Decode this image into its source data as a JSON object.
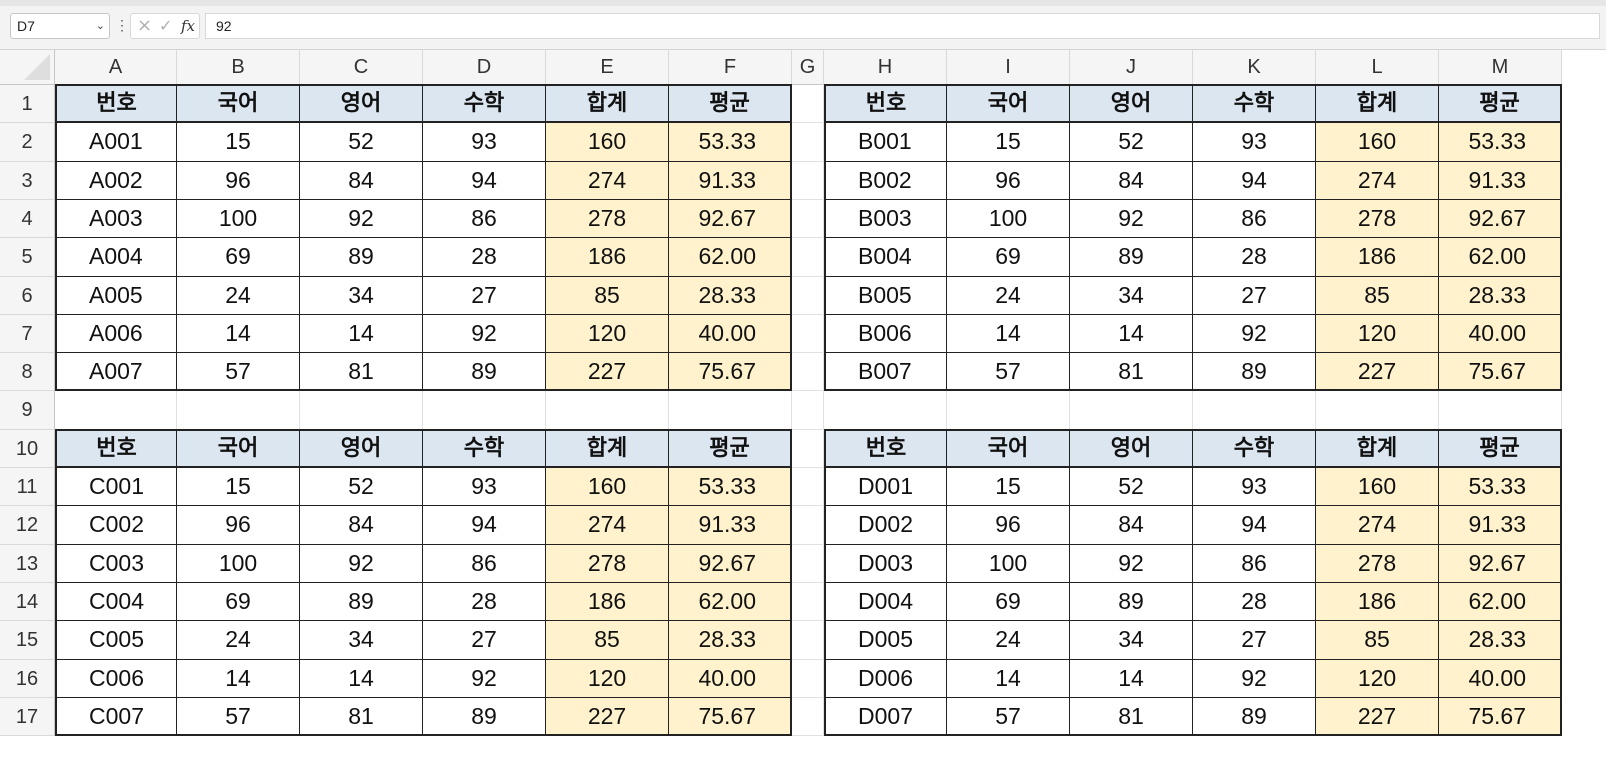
{
  "formula_bar": {
    "name_box": "D7",
    "formula": "92",
    "fx_label": "fx",
    "cancel_glyph": "×",
    "enter_glyph": "✓",
    "dropdown_glyph": "⌄",
    "dots_glyph": "⋮"
  },
  "columns": [
    "A",
    "B",
    "C",
    "D",
    "E",
    "F",
    "G",
    "H",
    "I",
    "J",
    "K",
    "L",
    "M"
  ],
  "rows": [
    "1",
    "2",
    "3",
    "4",
    "5",
    "6",
    "7",
    "8",
    "9",
    "10",
    "11",
    "12",
    "13",
    "14",
    "15",
    "16",
    "17"
  ],
  "colors": {
    "header_fill": "#dce6f1",
    "sum_fill": "#fff2cc",
    "border": "#222222"
  },
  "tables": [
    {
      "id": "A",
      "headers": [
        "번호",
        "국어",
        "영어",
        "수학",
        "합계",
        "평균"
      ],
      "rows": [
        [
          "A001",
          "15",
          "52",
          "93",
          "160",
          "53.33"
        ],
        [
          "A002",
          "96",
          "84",
          "94",
          "274",
          "91.33"
        ],
        [
          "A003",
          "100",
          "92",
          "86",
          "278",
          "92.67"
        ],
        [
          "A004",
          "69",
          "89",
          "28",
          "186",
          "62.00"
        ],
        [
          "A005",
          "24",
          "34",
          "27",
          "85",
          "28.33"
        ],
        [
          "A006",
          "14",
          "14",
          "92",
          "120",
          "40.00"
        ],
        [
          "A007",
          "57",
          "81",
          "89",
          "227",
          "75.67"
        ]
      ]
    },
    {
      "id": "B",
      "headers": [
        "번호",
        "국어",
        "영어",
        "수학",
        "합계",
        "평균"
      ],
      "rows": [
        [
          "B001",
          "15",
          "52",
          "93",
          "160",
          "53.33"
        ],
        [
          "B002",
          "96",
          "84",
          "94",
          "274",
          "91.33"
        ],
        [
          "B003",
          "100",
          "92",
          "86",
          "278",
          "92.67"
        ],
        [
          "B004",
          "69",
          "89",
          "28",
          "186",
          "62.00"
        ],
        [
          "B005",
          "24",
          "34",
          "27",
          "85",
          "28.33"
        ],
        [
          "B006",
          "14",
          "14",
          "92",
          "120",
          "40.00"
        ],
        [
          "B007",
          "57",
          "81",
          "89",
          "227",
          "75.67"
        ]
      ]
    },
    {
      "id": "C",
      "headers": [
        "번호",
        "국어",
        "영어",
        "수학",
        "합계",
        "평균"
      ],
      "rows": [
        [
          "C001",
          "15",
          "52",
          "93",
          "160",
          "53.33"
        ],
        [
          "C002",
          "96",
          "84",
          "94",
          "274",
          "91.33"
        ],
        [
          "C003",
          "100",
          "92",
          "86",
          "278",
          "92.67"
        ],
        [
          "C004",
          "69",
          "89",
          "28",
          "186",
          "62.00"
        ],
        [
          "C005",
          "24",
          "34",
          "27",
          "85",
          "28.33"
        ],
        [
          "C006",
          "14",
          "14",
          "92",
          "120",
          "40.00"
        ],
        [
          "C007",
          "57",
          "81",
          "89",
          "227",
          "75.67"
        ]
      ]
    },
    {
      "id": "D",
      "headers": [
        "번호",
        "국어",
        "영어",
        "수학",
        "합계",
        "평균"
      ],
      "rows": [
        [
          "D001",
          "15",
          "52",
          "93",
          "160",
          "53.33"
        ],
        [
          "D002",
          "96",
          "84",
          "94",
          "274",
          "91.33"
        ],
        [
          "D003",
          "100",
          "92",
          "86",
          "278",
          "92.67"
        ],
        [
          "D004",
          "69",
          "89",
          "28",
          "186",
          "62.00"
        ],
        [
          "D005",
          "24",
          "34",
          "27",
          "85",
          "28.33"
        ],
        [
          "D006",
          "14",
          "14",
          "92",
          "120",
          "40.00"
        ],
        [
          "D007",
          "57",
          "81",
          "89",
          "227",
          "75.67"
        ]
      ]
    }
  ]
}
